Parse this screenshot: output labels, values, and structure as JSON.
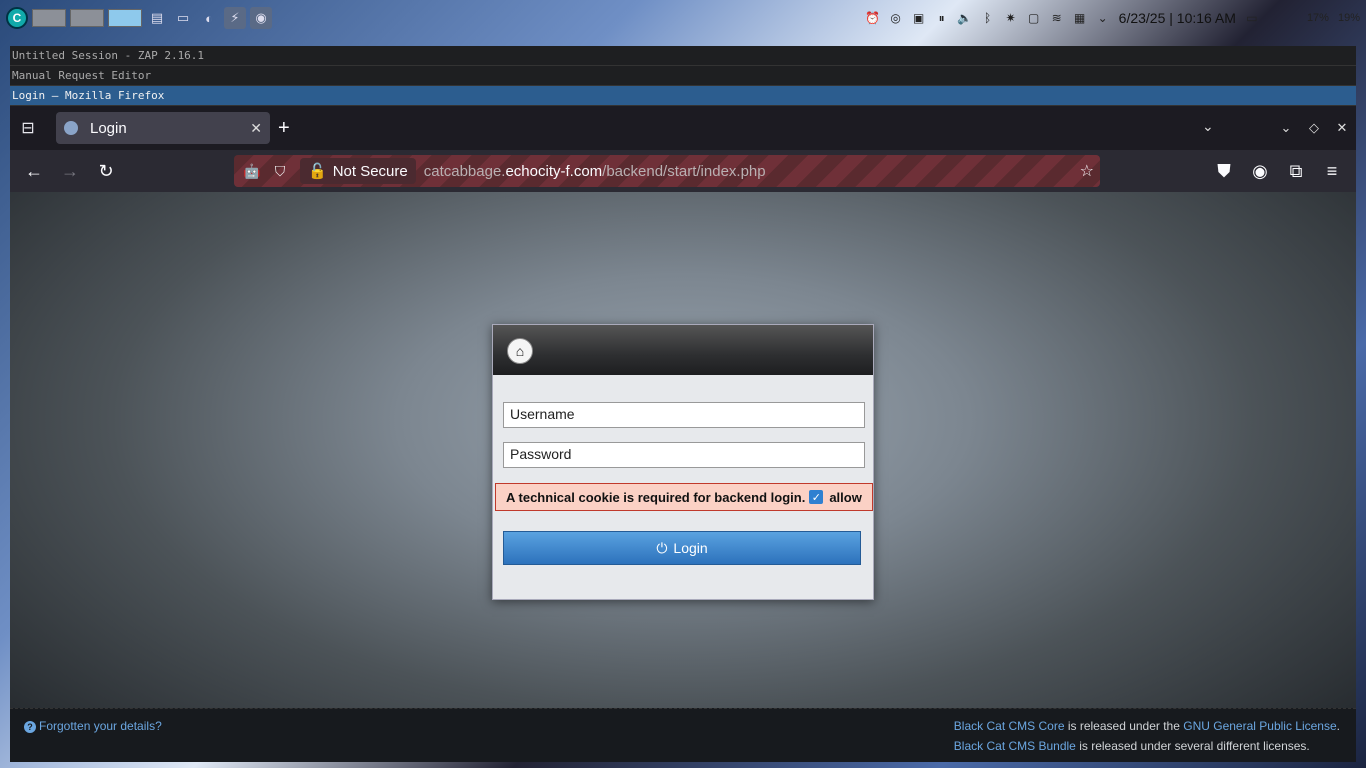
{
  "system_panel": {
    "tray_icons": [
      "alarm-icon",
      "updates-icon",
      "clipboard-icon",
      "pause-icon",
      "volume-icon",
      "bluetooth-icon",
      "brightness-icon",
      "device-icon",
      "wifi-icon",
      "display-icon",
      "chevron-down-icon"
    ],
    "datetime": "6/23/25 | 10:16 AM",
    "battery1": "17%",
    "battery2": "19%"
  },
  "windows": {
    "zap_title": "Untitled Session - ZAP 2.16.1",
    "manual_request_title": "Manual Request Editor",
    "firefox_title": "Login — Mozilla Firefox"
  },
  "browser": {
    "tab_title": "Login",
    "new_tab": "+",
    "url_security": "Not Secure",
    "url_prefix": "catcabbage.",
    "url_domain": "echocity-f.com",
    "url_path": "/backend/start/index.php"
  },
  "login": {
    "username_placeholder": "Username",
    "password_placeholder": "Password",
    "cookie_notice": "A technical cookie is required for backend login.",
    "cookie_allow": "allow",
    "login_button": "Login"
  },
  "footer": {
    "forgot_link": "Forgotten your details?",
    "core_link": "Black Cat CMS Core",
    "core_text": " is released under the ",
    "gpl_link": "GNU General Public License",
    "gpl_end": ".",
    "bundle_link": "Black Cat CMS Bundle",
    "bundle_text": " is released under several different licenses."
  }
}
